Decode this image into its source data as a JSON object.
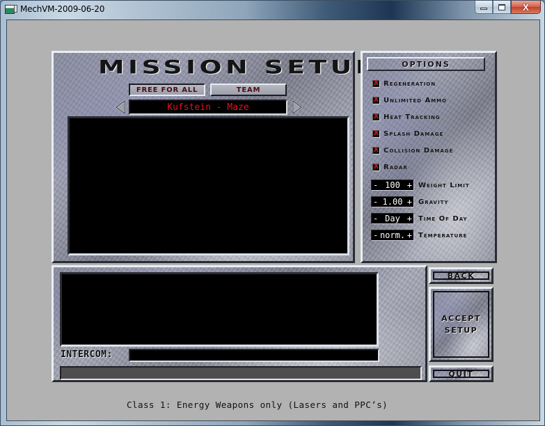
{
  "window": {
    "title": "MechVM-2009-06-20",
    "controls": {
      "minimize": "minimize",
      "maximize": "maximize",
      "close": "X"
    }
  },
  "mission_setup": {
    "title": "MISSION SETUP",
    "modes": [
      {
        "label": "FREE FOR ALL",
        "selected": true
      },
      {
        "label": "TEAM",
        "selected": false
      }
    ],
    "map_selector": {
      "prev_icon": "triangle-left-icon",
      "next_icon": "triangle-right-icon",
      "map_name": "Kufstein - Maze"
    }
  },
  "options": {
    "header": "OPTIONS",
    "toggles": [
      {
        "label": "Regeneration",
        "checked": true,
        "mark": "X"
      },
      {
        "label": "Unlimited Ammo",
        "checked": true,
        "mark": "X"
      },
      {
        "label": "Heat Tracking",
        "checked": true,
        "mark": "X"
      },
      {
        "label": "Splash Damage",
        "checked": true,
        "mark": "X"
      },
      {
        "label": "Collision Damage",
        "checked": true,
        "mark": "X"
      },
      {
        "label": "Radar",
        "checked": true,
        "mark": "X"
      }
    ],
    "steppers": [
      {
        "label": "Weight Limit",
        "value": "100",
        "minus": "-",
        "plus": "+"
      },
      {
        "label": "Gravity",
        "value": "1.00",
        "minus": "-",
        "plus": "+"
      },
      {
        "label": "Time Of Day",
        "value": "Day",
        "minus": "-",
        "plus": "+"
      },
      {
        "label": "Temperature",
        "value": "norm.",
        "minus": "-",
        "plus": "+"
      }
    ]
  },
  "chat": {
    "intercom_label": "INTERCOM:",
    "intercom_value": ""
  },
  "actions": {
    "back": "BACK",
    "accept_line1": "ACCEPT",
    "accept_line2": "SETUP",
    "quit": "QUIT"
  },
  "class_description": "Class 1: Energy Weapons only (Lasers and PPC’s)",
  "colors": {
    "map_name_text": "#e3121e",
    "checkbox_mark": "#e31c1c",
    "mode_button_text": "#4a0c10",
    "client_background": "#b2b2b2",
    "status_bar": "#4e4e4e"
  }
}
